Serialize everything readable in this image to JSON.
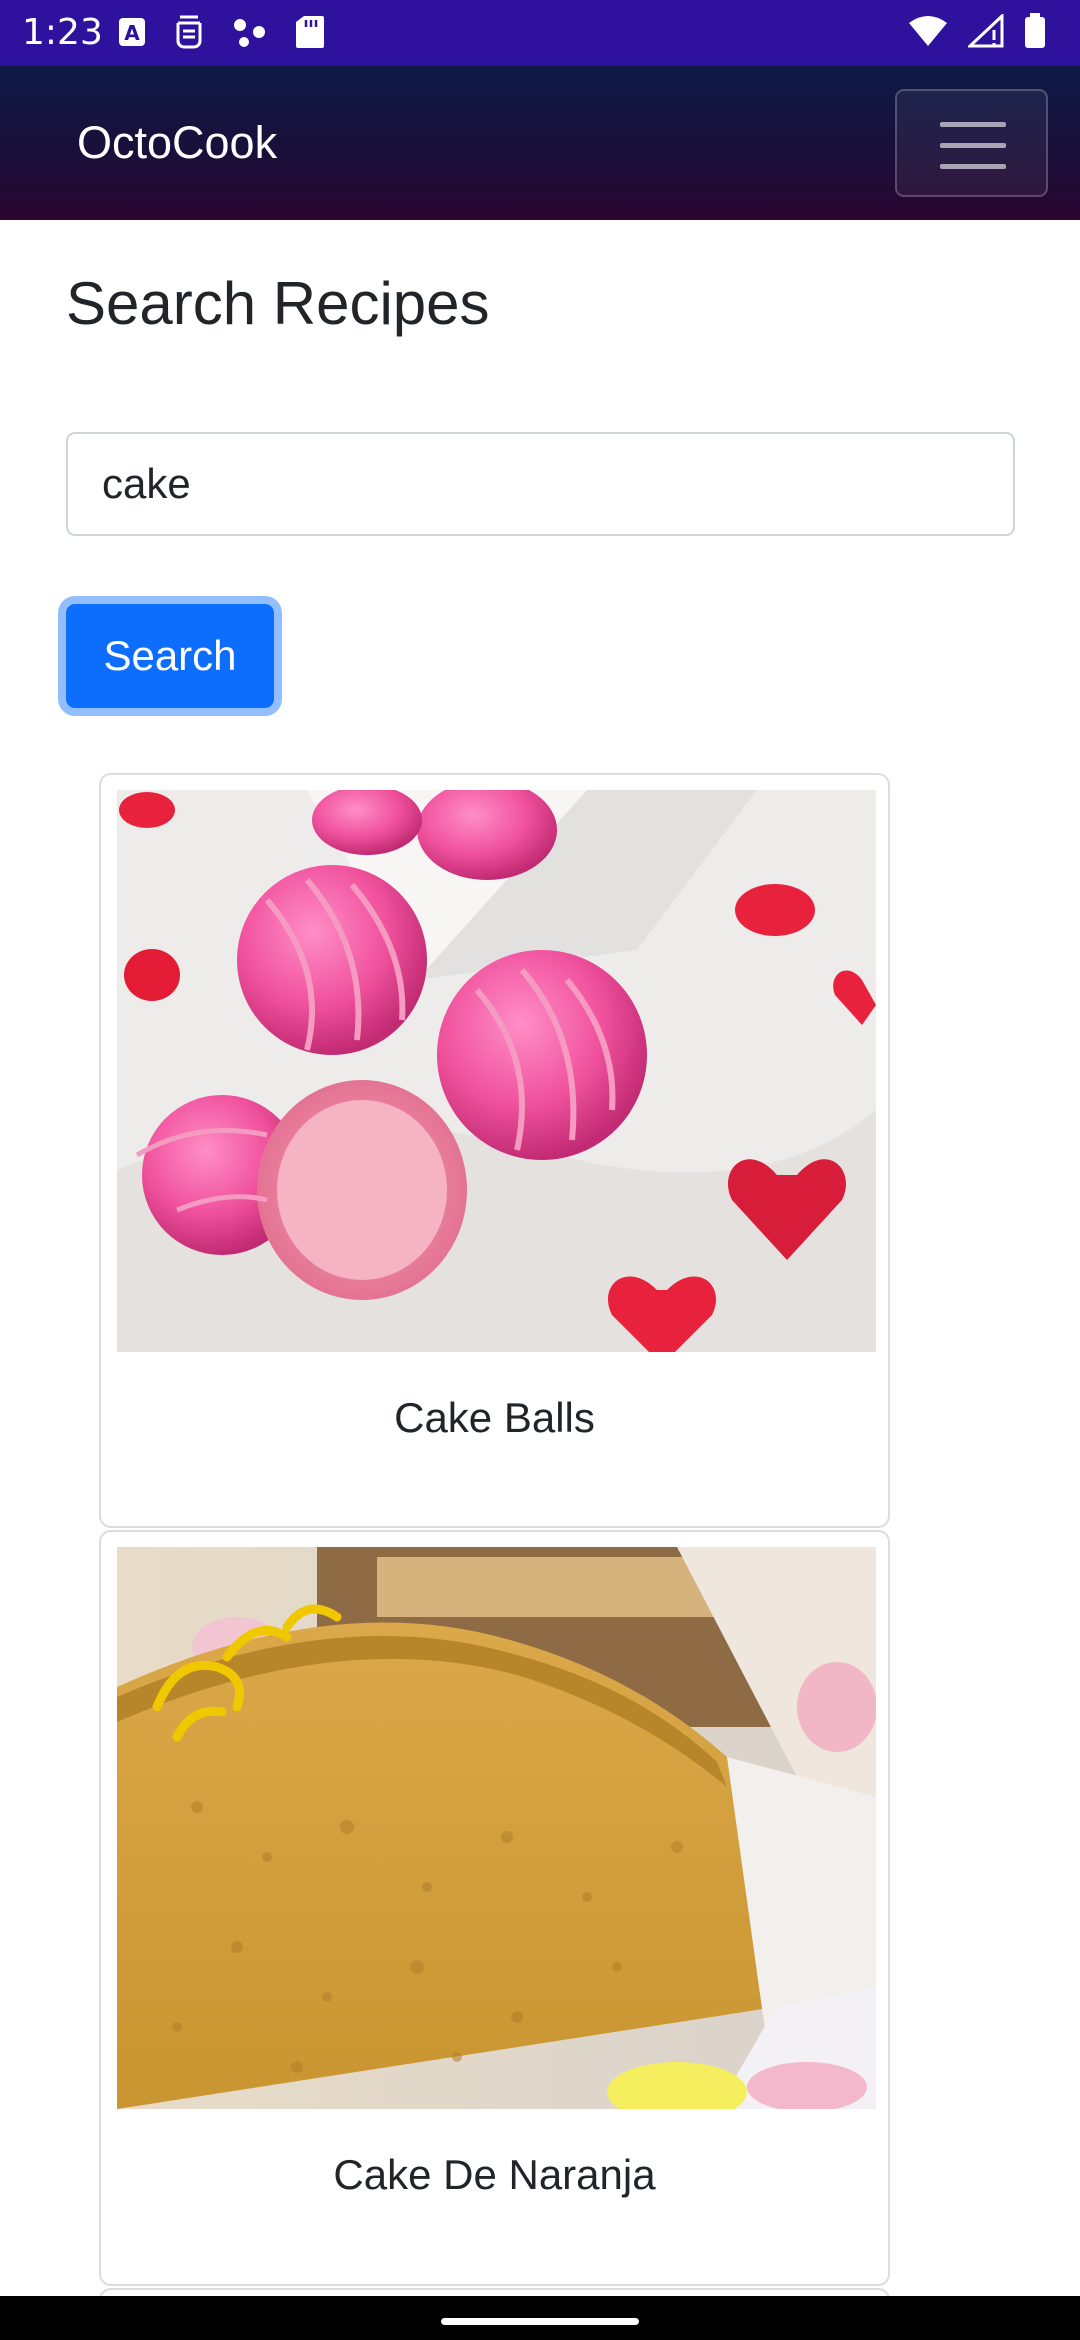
{
  "status_bar": {
    "time": "1:23",
    "icons_left": [
      "a-notification-icon",
      "sim-icon",
      "dots-network-icon",
      "sd-card-icon"
    ],
    "icons_right": [
      "wifi-icon",
      "cell-signal-icon",
      "battery-icon"
    ]
  },
  "navbar": {
    "brand": "OctoCook",
    "menu_icon": "hamburger-icon"
  },
  "search": {
    "title": "Search Recipes",
    "value": "cake",
    "button_label": "Search"
  },
  "results": [
    {
      "title": "Cake Balls"
    },
    {
      "title": "Cake De Naranja"
    }
  ],
  "colors": {
    "status_bar": "#2e129e",
    "primary_button": "#0d6efd"
  }
}
